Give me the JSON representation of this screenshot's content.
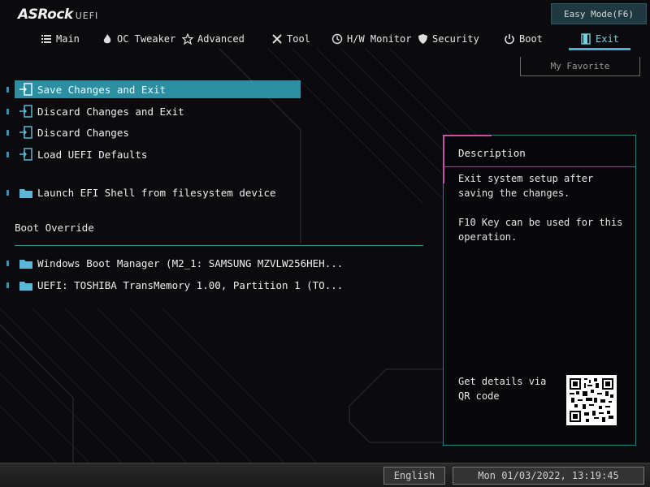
{
  "header": {
    "brand": "ASRock",
    "brand_suffix": "UEFI",
    "easy_mode_label": "Easy Mode(F6)"
  },
  "nav": {
    "items": [
      {
        "label": "Main",
        "icon": "list-icon"
      },
      {
        "label": "OC Tweaker",
        "icon": "flame-icon"
      },
      {
        "label": "Advanced",
        "icon": "star-icon"
      },
      {
        "label": "Tool",
        "icon": "tools-icon"
      },
      {
        "label": "H/W Monitor",
        "icon": "monitor-icon"
      },
      {
        "label": "Security",
        "icon": "shield-icon"
      },
      {
        "label": "Boot",
        "icon": "power-icon"
      },
      {
        "label": "Exit",
        "icon": "exit-door-icon"
      }
    ],
    "active": "Exit"
  },
  "favorite_label": "My Favorite",
  "menu": {
    "items": [
      {
        "label": "Save Changes and Exit",
        "icon": "exit-door-icon",
        "selected": true
      },
      {
        "label": "Discard Changes and Exit",
        "icon": "exit-door-icon"
      },
      {
        "label": "Discard Changes",
        "icon": "exit-door-icon"
      },
      {
        "label": "Load UEFI Defaults",
        "icon": "exit-door-icon"
      },
      {
        "label": "Launch EFI Shell from filesystem device",
        "icon": "folder-icon"
      }
    ],
    "boot_override_label": "Boot Override",
    "boot_items": [
      {
        "label": "Windows Boot Manager (M2_1: SAMSUNG MZVLW256HEH...",
        "icon": "folder-icon"
      },
      {
        "label": "UEFI: TOSHIBA TransMemory 1.00, Partition 1 (TO...",
        "icon": "folder-icon"
      }
    ]
  },
  "description": {
    "title": "Description",
    "text": "Exit system setup after saving the changes.\n\nF10 Key can be used for this operation.",
    "qr_label": "Get details via QR code"
  },
  "footer": {
    "language": "English",
    "datetime": "Mon 01/03/2022, 13:19:45"
  },
  "colors": {
    "accent": "#2b8ea3",
    "active_tab": "#6fd3e0",
    "panel_border": "#2f7e95",
    "highlight_magenta": "#d04ab0"
  }
}
